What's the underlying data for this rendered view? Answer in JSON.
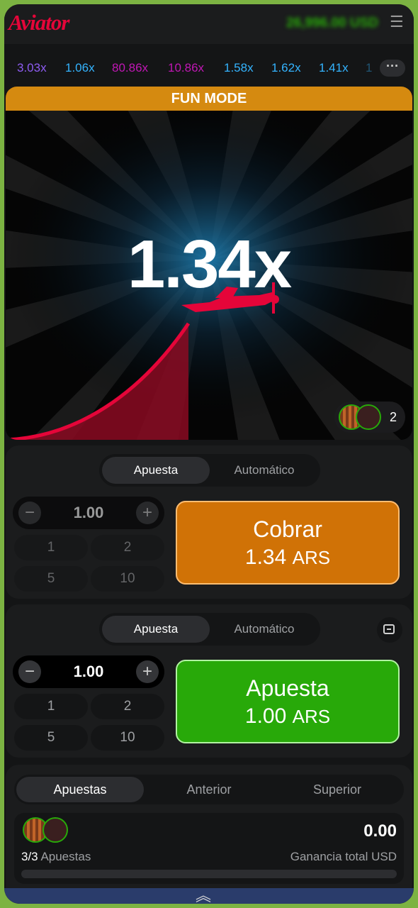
{
  "header": {
    "logo": "Aviator",
    "balance": "26,996.00 USD"
  },
  "history": {
    "items": [
      {
        "text": "3.03x",
        "color": "#8e5cf2"
      },
      {
        "text": "1.06x",
        "color": "#34b4ff"
      },
      {
        "text": "80.86x",
        "color": "#c017b4"
      },
      {
        "text": "10.86x",
        "color": "#c017b4"
      },
      {
        "text": "1.58x",
        "color": "#34b4ff"
      },
      {
        "text": "1.62x",
        "color": "#34b4ff"
      },
      {
        "text": "1.41x",
        "color": "#34b4ff"
      },
      {
        "text": "1",
        "color": "#34b4ff"
      }
    ]
  },
  "game": {
    "mode_label": "FUN MODE",
    "multiplier": "1.34x",
    "players_count": "2"
  },
  "panel1": {
    "tabs": [
      "Apuesta",
      "Automático"
    ],
    "amount": "1.00",
    "quick": [
      "1",
      "2",
      "5",
      "10"
    ],
    "action_label": "Cobrar",
    "action_amount": "1.34",
    "currency": "ARS"
  },
  "panel2": {
    "tabs": [
      "Apuesta",
      "Automático"
    ],
    "amount": "1.00",
    "quick": [
      "1",
      "2",
      "5",
      "10"
    ],
    "action_label": "Apuesta",
    "action_amount": "1.00",
    "currency": "ARS"
  },
  "bets": {
    "tabs": [
      "Apuestas",
      "Anterior",
      "Superior"
    ],
    "count": "3/3",
    "count_label": "Apuestas",
    "total": "0.00",
    "total_label": "Ganancia total USD",
    "cashout_progress": 0
  },
  "colors": {
    "accent": "#e50539",
    "cashout": "#d07206",
    "bet": "#28a909",
    "fun": "#d58a10"
  }
}
